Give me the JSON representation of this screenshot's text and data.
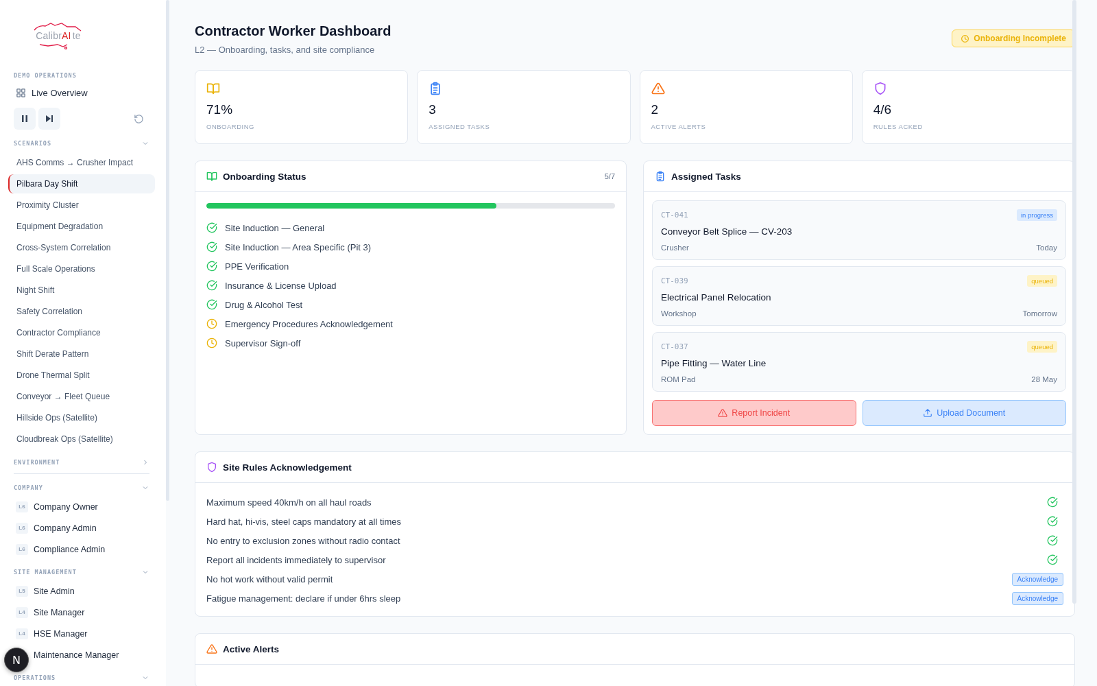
{
  "sidebar": {
    "logo": {
      "text": "Calibr",
      "accent": "AI",
      "tail": "te"
    },
    "demo_label": "DEMO OPERATIONS",
    "live_overview": "Live Overview",
    "scenarios": {
      "label": "SCENARIOS",
      "expanded": true,
      "items": [
        {
          "label": "AHS Comms → Crusher Impact",
          "selected": false
        },
        {
          "label": "Pilbara Day Shift",
          "selected": true
        },
        {
          "label": "Proximity Cluster",
          "selected": false
        },
        {
          "label": "Equipment Degradation",
          "selected": false
        },
        {
          "label": "Cross-System Correlation",
          "selected": false
        },
        {
          "label": "Full Scale Operations",
          "selected": false
        },
        {
          "label": "Night Shift",
          "selected": false
        },
        {
          "label": "Safety Correlation",
          "selected": false
        },
        {
          "label": "Contractor Compliance",
          "selected": false
        },
        {
          "label": "Shift Derate Pattern",
          "selected": false
        },
        {
          "label": "Drone Thermal Split",
          "selected": false
        },
        {
          "label": "Conveyor → Fleet Queue",
          "selected": false
        },
        {
          "label": "Hillside Ops (Satellite)",
          "selected": false
        },
        {
          "label": "Cloudbreak Ops (Satellite)",
          "selected": false
        }
      ]
    },
    "environment": {
      "label": "ENVIRONMENT",
      "expanded": false
    },
    "groups": [
      {
        "label": "COMPANY",
        "expanded": true,
        "items": [
          {
            "badge": "L6",
            "label": "Company Owner"
          },
          {
            "badge": "L6",
            "label": "Company Admin"
          },
          {
            "badge": "L6",
            "label": "Compliance Admin"
          }
        ]
      },
      {
        "label": "SITE MANAGEMENT",
        "expanded": true,
        "items": [
          {
            "badge": "L5",
            "label": "Site Admin"
          },
          {
            "badge": "L4",
            "label": "Site Manager"
          },
          {
            "badge": "L4",
            "label": "HSE Manager"
          },
          {
            "label": "Maintenance Manager"
          }
        ]
      },
      {
        "label": "OPERATIONS",
        "expanded": true
      }
    ]
  },
  "floating_button": "N",
  "header": {
    "title": "Contractor Worker Dashboard",
    "subtitle": "L2 — Onboarding, tasks, and site compliance",
    "status_badge": "Onboarding Incomplete"
  },
  "stats": [
    {
      "kind": "book",
      "value": "71%",
      "label": "ONBOARDING"
    },
    {
      "kind": "clipboard",
      "value": "3",
      "label": "ASSIGNED TASKS"
    },
    {
      "kind": "alert",
      "value": "2",
      "label": "ACTIVE ALERTS"
    },
    {
      "kind": "shield",
      "value": "4/6",
      "label": "RULES ACKED"
    }
  ],
  "onboarding": {
    "title": "Onboarding Status",
    "count": "5/7",
    "level": 0.71,
    "items": [
      {
        "label": "Site Induction — General",
        "done": true
      },
      {
        "label": "Site Induction — Area Specific (Pit 3)",
        "done": true
      },
      {
        "label": "PPE Verification",
        "done": true
      },
      {
        "label": "Insurance & License Upload",
        "done": true
      },
      {
        "label": "Drug & Alcohol Test",
        "done": true
      },
      {
        "label": "Emergency Procedures Acknowledgement",
        "done": false
      },
      {
        "label": "Supervisor Sign-off",
        "done": false
      }
    ]
  },
  "tasks": {
    "title": "Assigned Tasks",
    "items": [
      {
        "id": "CT-041",
        "kind": "active",
        "status": "in progress",
        "title": "Conveyor Belt Splice — CV-203",
        "location": "Crusher",
        "due": "Today"
      },
      {
        "id": "CT-039",
        "kind": "waiting",
        "status": "queued",
        "title": "Electrical Panel Relocation",
        "location": "Workshop",
        "due": "Tomorrow"
      },
      {
        "id": "CT-037",
        "kind": "waiting",
        "status": "queued",
        "title": "Pipe Fitting — Water Line",
        "location": "ROM Pad",
        "due": "28 May"
      }
    ],
    "buttons": [
      {
        "kind": "danger",
        "label": "Report Incident"
      },
      {
        "kind": "primary",
        "label": "Upload Document"
      }
    ]
  },
  "rules": {
    "title": "Site Rules Acknowledgement",
    "items": [
      {
        "label": "Maximum speed 40km/h on all haul roads",
        "acked": true
      },
      {
        "label": "Hard hat, hi-vis, steel caps mandatory at all times",
        "acked": true
      },
      {
        "label": "No entry to exclusion zones without radio contact",
        "acked": true
      },
      {
        "label": "Report all incidents immediately to supervisor",
        "acked": true
      },
      {
        "label": "No hot work without valid permit",
        "acked": false,
        "action": "Acknowledge"
      },
      {
        "label": "Fatigue management: declare if under 6hrs sleep",
        "acked": false,
        "action": "Acknowledge"
      }
    ]
  },
  "alerts": {
    "title": "Active Alerts"
  }
}
